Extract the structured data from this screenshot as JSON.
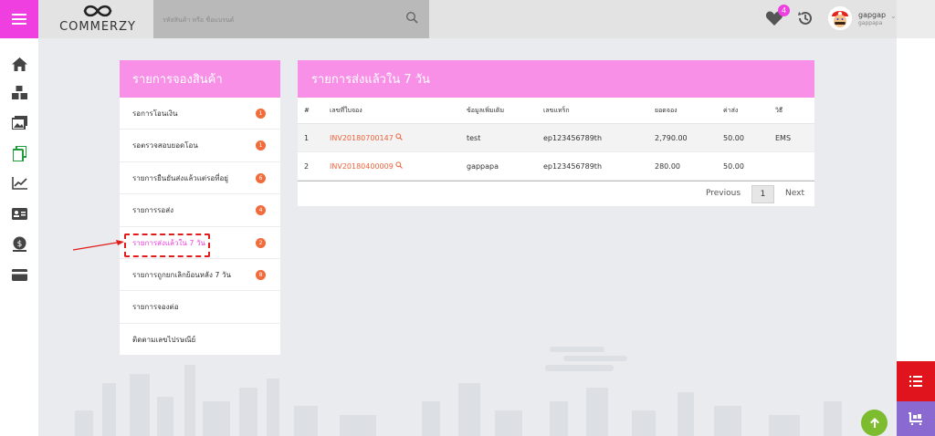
{
  "topbar": {
    "logo_text": "COMMERZY",
    "search_placeholder": "รหัสสินค้า หรือ ชื่อแบรนด์",
    "wishlist_count": "4",
    "user_name": "gapgap",
    "user_sub": "gappapa"
  },
  "orders_panel": {
    "title": "รายการจองสินค้า",
    "items": [
      {
        "label": "รอการโอนเงิน",
        "count": "1"
      },
      {
        "label": "รอตรวจสอบยอดโอน",
        "count": "1"
      },
      {
        "label": "รายการยืนยันส่งแล้วแต่รอที่อยู่",
        "count": "6"
      },
      {
        "label": "รายการรอส่ง",
        "count": "4"
      },
      {
        "label": "รายการส่งแล้วใน 7 วัน",
        "count": "2"
      },
      {
        "label": "รายการถูกยกเลิกย้อนหลัง 7 วัน",
        "count": "8"
      },
      {
        "label": "รายการจองต่อ",
        "count": ""
      },
      {
        "label": "ติดตามเลขไปรษณีย์",
        "count": ""
      }
    ]
  },
  "shipped_panel": {
    "title": "รายการส่งแล้วใน 7 วัน",
    "columns": [
      "#",
      "เลขที่ใบจอง",
      "ข้อมูลเพิ่มเติม",
      "เลขแทร็ก",
      "ยอดจอง",
      "ค่าส่ง",
      "วิธี"
    ],
    "rows": [
      {
        "no": "1",
        "invoice": "INV20180700147",
        "info": "test",
        "tracking": "ep123456789th",
        "amount": "2,790.00",
        "shipping": "50.00",
        "method": "EMS"
      },
      {
        "no": "2",
        "invoice": "INV20180400009",
        "info": "gappapa",
        "tracking": "ep123456789th",
        "amount": "280.00",
        "shipping": "50.00",
        "method": ""
      }
    ],
    "pager": {
      "previous": "Previous",
      "page": "1",
      "next": "Next"
    }
  },
  "colors": {
    "brand_pink": "#f03fe0",
    "header_pink": "#f890e8",
    "count_badge": "#f26b3a",
    "invoice_link": "#f0633c",
    "annotation_red": "#e21b1b",
    "fab_red": "#e0141c",
    "fab_purple": "#8a6ad0",
    "fab_green": "#7dbb2f"
  },
  "icons": [
    "menu-icon",
    "infinity-logo-icon",
    "search-icon",
    "heart-icon",
    "history-icon",
    "home-icon",
    "boxes-icon",
    "photos-icon",
    "copy-icon",
    "chart-icon",
    "id-card-icon",
    "coin-icon",
    "credit-card-icon",
    "list-icon",
    "cart-icon",
    "arrow-up-icon"
  ]
}
